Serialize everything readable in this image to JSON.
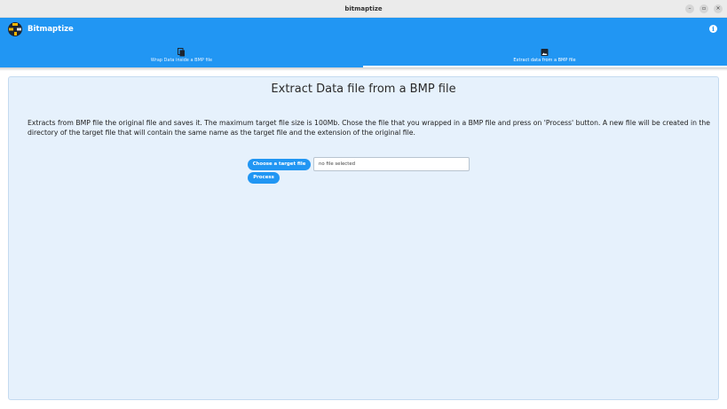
{
  "window": {
    "title": "bitmaptize",
    "controls": {
      "minimize": "–",
      "maximize": "▫",
      "close": "×"
    }
  },
  "app": {
    "title": "Bitmaptize",
    "logo_icon": "bitmaptize-logo",
    "info_icon": "info-icon",
    "accent_color": "#2196f3"
  },
  "tabs": [
    {
      "label": "Wrap Data inside a BMP file",
      "icon": "file-copy-icon",
      "selected": false
    },
    {
      "label": "Extract data from a BMP file",
      "icon": "image-icon",
      "selected": true
    }
  ],
  "main": {
    "title": "Extract Data file from a BMP file",
    "description": "Extracts from BMP file the original file and saves it. The maximum target file size is 100Mb. Chose the file that you wrapped in a BMP file and press on 'Process' button. A new file will be created in the directory of the target file that will contain the same name as the target file and the extension of the original file.",
    "choose_button_label": "Choose a target file",
    "file_status": "no file selected",
    "process_button_label": "Process"
  }
}
